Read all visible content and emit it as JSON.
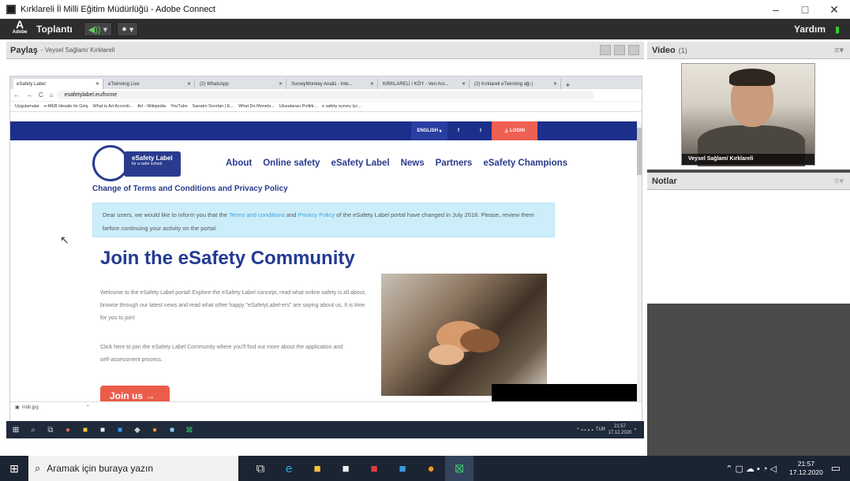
{
  "window": {
    "title": "Kırklareli İl Milli Eğitim Müdürlüğü - Adobe Connect",
    "min": "–",
    "max": "□",
    "close": "✕"
  },
  "menubar": {
    "logo": "Adobe",
    "meeting": "Toplantı",
    "help": "Yardım"
  },
  "share_pod": {
    "title": "Paylaş",
    "presenter": "- Veysel Sağlam/ Kırklareli"
  },
  "browser": {
    "tabs": [
      "eSafety Label",
      "eTwinning Live",
      "(2) WhatsApp",
      "SurveyMonkey Analiz - Inte...",
      "KIRKLARELİ / KÖY - Veri Aro...",
      "(2) Kırklareli eTwinning ağı |"
    ],
    "url": "esafetylabel.eu/home",
    "bookmarks": [
      "Uygulamalar",
      "e-MEB Hesabı ile Giriş",
      "What is Art Accordi...",
      "Art - Wikipedia",
      "YouTube",
      "Sanatın Sınırları | E...",
      "What Do Monets...",
      "Ulusalarası Politik...",
      "e safety survey lyc..."
    ]
  },
  "site": {
    "lang": "ENGLISH",
    "fb": "f",
    "tw": "t",
    "login": "LOGIN",
    "logo_title": "eSafety Label",
    "logo_sub": "for a safer school",
    "nav": [
      "About",
      "Online safety",
      "eSafety Label",
      "News",
      "Partners",
      "eSafety Champions"
    ],
    "change_title": "Change of Terms and Conditions and Privacy Policy",
    "notice_p1": "Dear users, we would like to inform you that the ",
    "notice_link1": "Terms and conditions",
    "notice_p2": " and ",
    "notice_link2": "Privacy Policy",
    "notice_p3": " of the eSafety Label portal have changed in July 2018. Please, review them before continuing your activity on the portal.",
    "join_title": "Join the eSafety Community",
    "welcome": "Welcome to the eSafety Label portal! Explore the eSafety Label concept, read what online safety is all about, browse through our latest news and read what other happy \"eSafetyLabel-ers\" are saying about us. It is time for you to join!",
    "click_here": "Click here to join the eSafety Label Community where you'll find out more about the application and self-assessment process.",
    "join_btn": "Join us →"
  },
  "download": {
    "file": "indir.jpg"
  },
  "inner_taskbar": {
    "lang": "TUR",
    "time": "21:57",
    "date": "17.12.2020"
  },
  "video_pod": {
    "title": "Video",
    "count": "(1)",
    "name": "Veysel Sağlam/ Kırklareli"
  },
  "notes_pod": {
    "title": "Notlar"
  },
  "taskbar": {
    "search_placeholder": "Aramak için buraya yazın",
    "time": "21:57",
    "date": "17.12.2020"
  }
}
